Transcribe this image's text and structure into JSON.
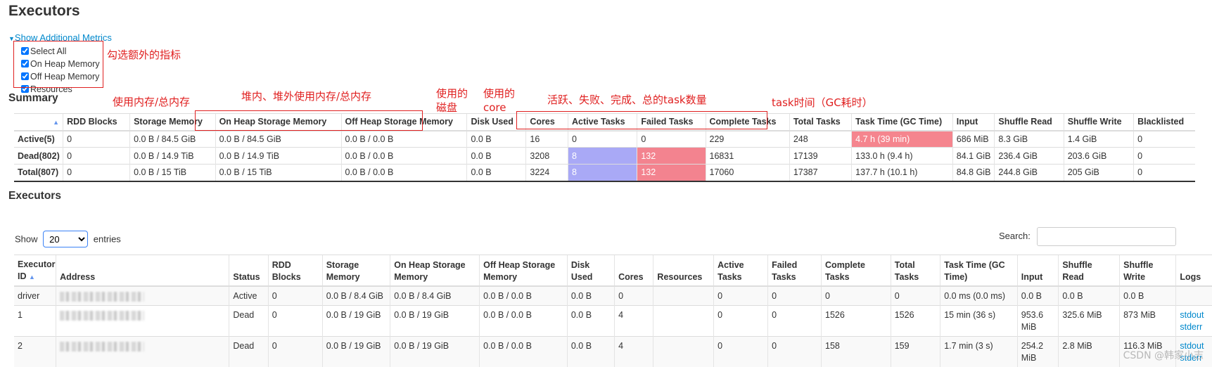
{
  "page": {
    "title": "Executors"
  },
  "metrics": {
    "toggle_label": "Show Additional Metrics",
    "options": [
      {
        "label": "Select All",
        "checked": true
      },
      {
        "label": "On Heap Memory",
        "checked": true
      },
      {
        "label": "Off Heap Memory",
        "checked": true
      },
      {
        "label": "Resources",
        "checked": true
      }
    ]
  },
  "summary": {
    "title": "Summary",
    "headers": [
      "",
      "RDD Blocks",
      "Storage Memory",
      "On Heap Storage Memory",
      "Off Heap Storage Memory",
      "Disk Used",
      "Cores",
      "Active Tasks",
      "Failed Tasks",
      "Complete Tasks",
      "Total Tasks",
      "Task Time (GC Time)",
      "Input",
      "Shuffle Read",
      "Shuffle Write",
      "Blacklisted"
    ],
    "rows": [
      [
        "Active(5)",
        "0",
        "0.0 B / 84.5 GiB",
        "0.0 B / 84.5 GiB",
        "0.0 B / 0.0 B",
        "0.0 B",
        "16",
        "0",
        "0",
        "229",
        "248",
        "4.7 h (39 min)",
        "686 MiB",
        "8.3 GiB",
        "1.4 GiB",
        "0"
      ],
      [
        "Dead(802)",
        "0",
        "0.0 B / 14.9 TiB",
        "0.0 B / 14.9 TiB",
        "0.0 B / 0.0 B",
        "0.0 B",
        "3208",
        "8",
        "132",
        "16831",
        "17139",
        "133.0 h (9.4 h)",
        "84.1 GiB",
        "236.4 GiB",
        "203.6 GiB",
        "0"
      ],
      [
        "Total(807)",
        "0",
        "0.0 B / 15 TiB",
        "0.0 B / 15 TiB",
        "0.0 B / 0.0 B",
        "0.0 B",
        "3224",
        "8",
        "132",
        "17060",
        "17387",
        "137.7 h (10.1 h)",
        "84.8 GiB",
        "244.8 GiB",
        "205 GiB",
        "0"
      ]
    ]
  },
  "executors": {
    "title": "Executors",
    "show_label": "Show",
    "entries_label": "entries",
    "page_size": "20",
    "search_label": "Search:",
    "search_value": "",
    "headers": [
      "Executor ID",
      "Address",
      "Status",
      "RDD Blocks",
      "Storage Memory",
      "On Heap Storage Memory",
      "Off Heap Storage Memory",
      "Disk Used",
      "Cores",
      "Resources",
      "Active Tasks",
      "Failed Tasks",
      "Complete Tasks",
      "Total Tasks",
      "Task Time (GC Time)",
      "Input",
      "Shuffle Read",
      "Shuffle Write",
      "Logs"
    ],
    "rows": [
      {
        "cells": [
          "driver",
          "",
          "Active",
          "0",
          "0.0 B / 8.4 GiB",
          "0.0 B / 8.4 GiB",
          "0.0 B / 0.0 B",
          "0.0 B",
          "0",
          "",
          "0",
          "0",
          "0",
          "0",
          "0.0 ms (0.0 ms)",
          "0.0 B",
          "0.0 B",
          "0.0 B"
        ],
        "logs": []
      },
      {
        "cells": [
          "1",
          "",
          "Dead",
          "0",
          "0.0 B / 19 GiB",
          "0.0 B / 19 GiB",
          "0.0 B / 0.0 B",
          "0.0 B",
          "4",
          "",
          "0",
          "0",
          "1526",
          "1526",
          "15 min (36 s)",
          "953.6 MiB",
          "325.6 MiB",
          "873 MiB"
        ],
        "logs": [
          "stdout",
          "stderr"
        ]
      },
      {
        "cells": [
          "2",
          "",
          "Dead",
          "0",
          "0.0 B / 19 GiB",
          "0.0 B / 19 GiB",
          "0.0 B / 0.0 B",
          "0.0 B",
          "4",
          "",
          "0",
          "0",
          "158",
          "159",
          "1.7 min (3 s)",
          "254.2 MiB",
          "2.8 MiB",
          "116.3 MiB"
        ],
        "logs": [
          "stdout",
          "stderr"
        ]
      }
    ]
  },
  "annotations": {
    "metrics": "勾选额外的指标",
    "storage_memory": "使用内存/总内存",
    "heap_memory": "堆内、堆外使用内存/总内存",
    "disk": "使用的\n磁盘",
    "cores": "使用的\ncore",
    "tasks": "活跃、失败、完成、总的task数量",
    "task_time": "task时间（GC耗时）"
  },
  "watermark": "CSDN @韩家小志",
  "colors": {
    "active_tasks_bg": "#a9a9f6",
    "failed_tasks_bg": "#f3838f",
    "gc_time_bg": "#f5858e",
    "link": "#0088cc",
    "annotation": "#e02020"
  }
}
